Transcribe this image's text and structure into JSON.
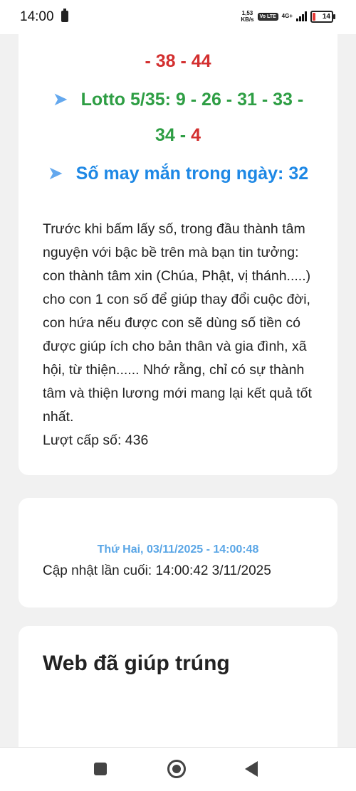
{
  "status_bar": {
    "time": "14:00",
    "net_speed_value": "1,53",
    "net_speed_unit": "KB/s",
    "volte": "Vo LTE",
    "network": "4G+",
    "battery": "14"
  },
  "results": {
    "partial_line": "- 38 - 44",
    "lotto_line_1": "Lotto 5/35: 9 - 26 - 31 - 33 -",
    "lotto_line_2_green": "34 - ",
    "lotto_line_2_red": "4",
    "lucky_line": "Số may mắn trong ngày: 32"
  },
  "description": "Trước khi bấm lấy số, trong đầu thành tâm nguyện với bậc bề trên mà bạn tin tưởng: con thành tâm xin (Chúa, Phật, vị thánh.....) cho con 1 con số để giúp thay đổi cuộc đời, con hứa nếu được con sẽ dùng số tiền có được giúp ích cho bản thân và gia đình, xã hội, từ thiện...... Nhớ rằng, chỉ có sự thành tâm và thiện lương mới mang lại kết quả tốt nhất.",
  "issued_count": "Lượt cấp số: 436",
  "datetime": "Thứ Hai, 03/11/2025 - 14:00:48",
  "last_update": "Cập nhật lần cuối: 14:00:42 3/11/2025",
  "section_title": "Web đã giúp trúng",
  "icons": {
    "arrow": "➤",
    "nav_recents": "square-icon",
    "nav_home": "circle-home-icon",
    "nav_back": "triangle-back-icon"
  },
  "colors": {
    "red": "#d32f2f",
    "green": "#2e9e44",
    "blue": "#1e88e5",
    "date_blue": "#5aa6e6"
  }
}
